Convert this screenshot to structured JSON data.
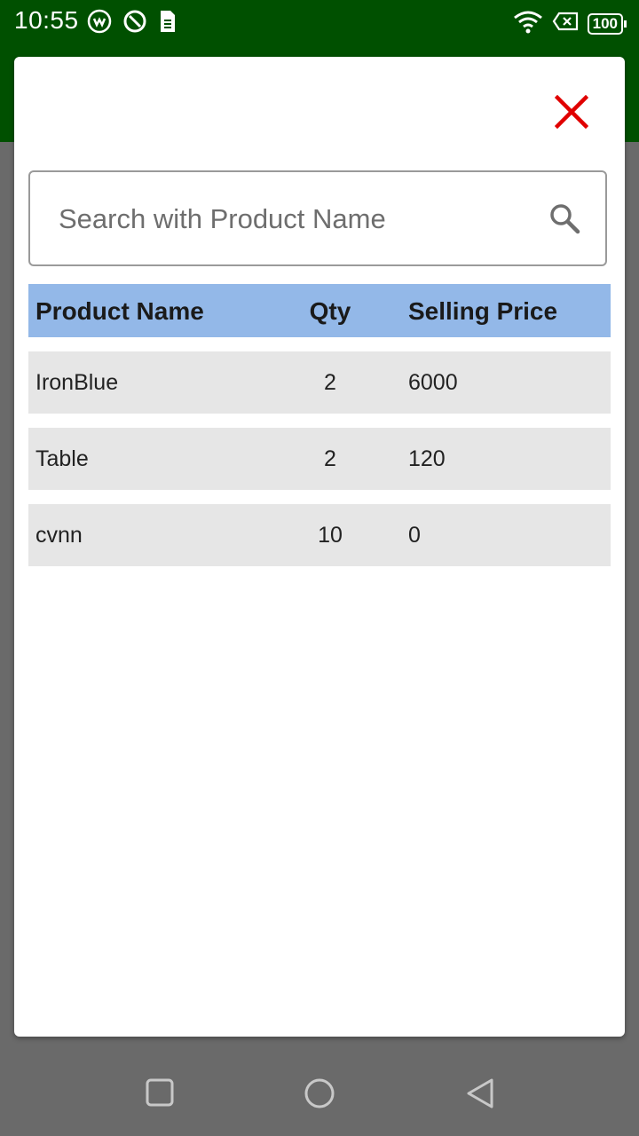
{
  "status_bar": {
    "time": "10:55",
    "battery": "100",
    "icons": [
      "whatsapp-icon",
      "sync-icon",
      "sim-icon",
      "wifi-icon",
      "no-sim-icon",
      "battery-icon"
    ]
  },
  "dialog": {
    "close_icon": "close-icon",
    "search": {
      "placeholder": "Search with Product Name",
      "value": ""
    },
    "table": {
      "headers": {
        "name": "Product Name",
        "qty": "Qty",
        "price": "Selling Price"
      },
      "rows": [
        {
          "name": "IronBlue",
          "qty": "2",
          "price": "6000"
        },
        {
          "name": "Table",
          "qty": "2",
          "price": "120"
        },
        {
          "name": "cvnn",
          "qty": "10",
          "price": "0"
        }
      ]
    }
  },
  "nav_bar": {
    "icons": [
      "recents-icon",
      "home-icon",
      "back-icon"
    ]
  },
  "colors": {
    "status_bar": "#005000",
    "table_header": "#93b8e8",
    "row_bg": "#e6e6e6",
    "close": "#e00000",
    "scrim": "#6a6a6a"
  }
}
